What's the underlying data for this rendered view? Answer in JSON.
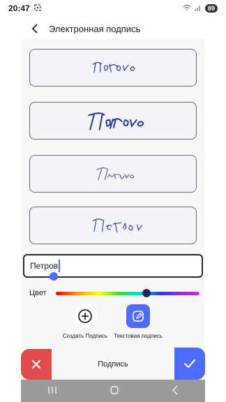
{
  "status_bar": {
    "time": "20:47",
    "battery": "89",
    "icons": [
      "screenshot-icon",
      "wifi-icon",
      "signal-icon"
    ]
  },
  "header": {
    "title": "Электронная подпись",
    "back_icon": "chevron-left-icon"
  },
  "signatures": [
    {
      "text": "Петров",
      "style": "script-thin"
    },
    {
      "text": "Петров",
      "style": "script-bold"
    },
    {
      "text": "Петров",
      "style": "script-small"
    },
    {
      "text": "Петров",
      "style": "script-spaced"
    }
  ],
  "name_input": {
    "value": "Петров"
  },
  "color_picker": {
    "label": "Цвет",
    "selected_position": 0.63,
    "selected_color": "#1f2a5a"
  },
  "tools": {
    "create_label": "Создать Подпись",
    "text_label": "Текстовая подпись"
  },
  "bottom": {
    "title": "Подпись",
    "cancel_color": "#e24b4b",
    "confirm_color": "#4d6bff"
  },
  "nav": {
    "recent_icon": "recent-apps-icon",
    "home_icon": "home-icon",
    "back_icon": "back-icon"
  }
}
